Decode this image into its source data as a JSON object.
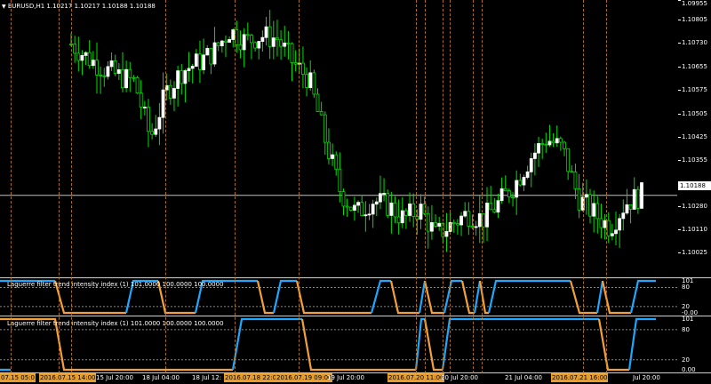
{
  "window": {
    "symbol_caption": "EURUSD,H1  1.10217 1.10217 1.10188 1.10188",
    "current_price": "1.10188"
  },
  "price_axis": [
    "1.10805",
    "1.10730",
    "1.10655",
    "1.10575",
    "1.10505",
    "1.10425",
    "1.10355",
    "1.10280",
    "1.10110",
    "1.10025",
    "1.09955"
  ],
  "indicator1": {
    "title": "Laguerre filter trend intensity index (1) 101.0000 100.0000 100.0000",
    "axis": [
      "101",
      "80",
      "20",
      "-0.00"
    ]
  },
  "indicator2": {
    "title": "Laguerre filter trend intensity index (1) 101.0000 100.0000 100.0000",
    "axis": [
      "101",
      "80",
      "20",
      "0.00"
    ]
  },
  "time_axis": [
    {
      "text": "07.15 05:0",
      "boxed": true
    },
    {
      "text": "2016.07.15 14:00",
      "boxed": true
    },
    {
      "text": "15 Jul 20:00",
      "boxed": false
    },
    {
      "text": "18 Jul 04:00",
      "boxed": false
    },
    {
      "text": "18 Jul 12:",
      "boxed": false
    },
    {
      "text": "2016.07.18 22:00",
      "boxed": true
    },
    {
      "text": "2016.07.19 09:00",
      "boxed": true
    },
    {
      "text": "19 Jul 20:00",
      "boxed": false
    },
    {
      "text": "2016.07.20 11:00",
      "boxed": true
    },
    {
      "text": "20 Jul 20:00",
      "boxed": false
    },
    {
      "text": "21 Jul 04:00",
      "boxed": false
    },
    {
      "text": "2016.07.21 16:00",
      "boxed": true
    },
    {
      "text": "Jul 20:00",
      "boxed": false
    }
  ],
  "colors": {
    "bull": "#ffffff",
    "bear": "#00e000",
    "wick": "#00e000",
    "cyan": "#1ea7ff",
    "orange": "#f2a03c",
    "event_line": "#c87f1e",
    "background": "#000000"
  },
  "chart_data": {
    "type": "candlestick",
    "symbol": "EURUSD",
    "timeframe": "H1",
    "ohlc_caption": {
      "open": 1.10217,
      "high": 1.10217,
      "low": 1.10188,
      "close": 1.10188
    },
    "price_range": [
      1.0991,
      1.1088
    ],
    "close_path_approx": [
      1.1075,
      1.107,
      1.1066,
      1.1063,
      1.1061,
      1.104,
      1.1057,
      1.1065,
      1.1068,
      1.1072,
      1.108,
      1.1076,
      1.1078,
      1.1077,
      1.1068,
      1.1062,
      1.104,
      1.102,
      1.1012,
      1.1017,
      1.1015,
      1.101,
      1.1014,
      1.1004,
      1.1008,
      1.1012,
      1.101,
      1.1016,
      1.1023,
      1.1033,
      1.104,
      1.1036,
      1.1018,
      1.1012,
      1.1007,
      1.1016,
      1.1019
    ],
    "indicator_levels": [
      101,
      80,
      20,
      0
    ]
  }
}
